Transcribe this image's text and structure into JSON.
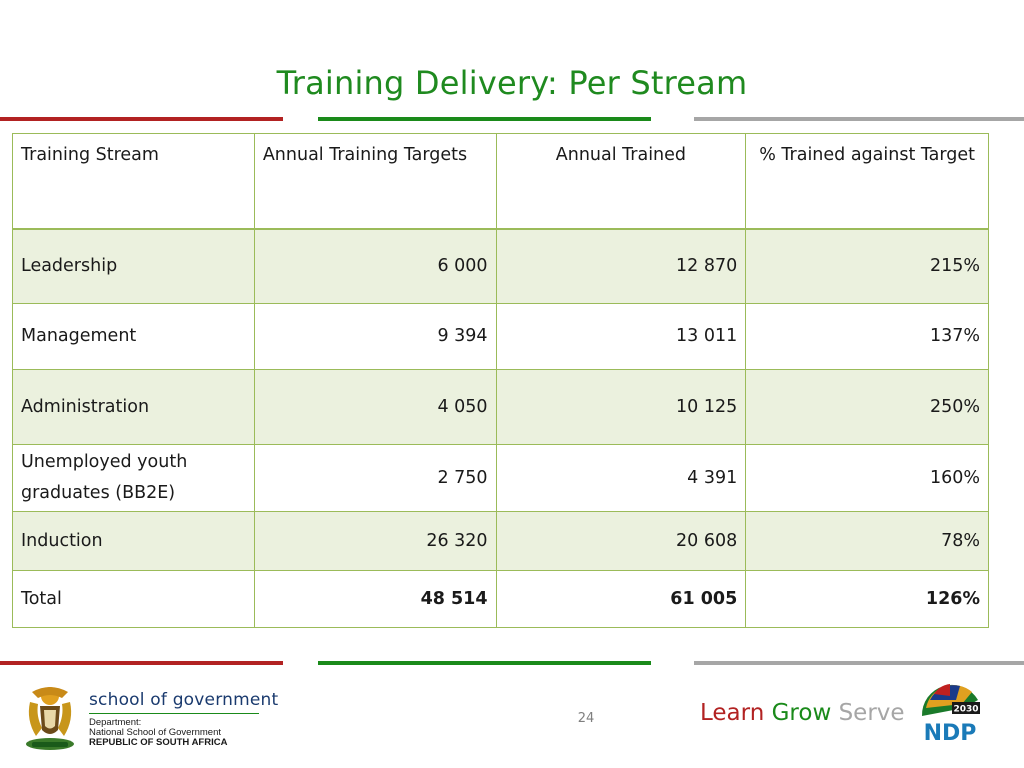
{
  "slide": {
    "title": "Training Delivery: Per Stream",
    "page_number": "24"
  },
  "table": {
    "headers": [
      "Training Stream",
      "Annual Training Targets",
      "Annual Trained",
      "% Trained against Target"
    ],
    "rows": [
      {
        "stream": "Leadership",
        "target": "6 000",
        "trained": "12 870",
        "percent": "215%"
      },
      {
        "stream": "Management",
        "target": "9 394",
        "trained": "13 011",
        "percent": "137%"
      },
      {
        "stream": "Administration",
        "target": "4 050",
        "trained": "10 125",
        "percent": "250%"
      },
      {
        "stream": "Unemployed youth graduates (BB2E)",
        "target": "2 750",
        "trained": "4 391",
        "percent": "160%"
      },
      {
        "stream": "Induction",
        "target": "26 320",
        "trained": "20 608",
        "percent": "78%"
      },
      {
        "stream": "Total",
        "target": "48 514",
        "trained": "61 005",
        "percent": "126%"
      }
    ]
  },
  "footer": {
    "logo_title": "school of government",
    "department_line1": "Department:",
    "department_line2": "National School of Government",
    "country": "REPUBLIC OF SOUTH AFRICA",
    "slogan_word1": "Learn",
    "slogan_word2": "Grow",
    "slogan_word3": "Serve",
    "ndp_logo_text": "NDP",
    "ndp_year": "2030"
  },
  "colors": {
    "title_green": "#1f8a1f",
    "accent_red": "#b22222",
    "accent_green": "#1a8a1a",
    "accent_grey": "#a6a6a6",
    "table_border": "#9bbb59",
    "row_shade": "#ebf1de"
  }
}
